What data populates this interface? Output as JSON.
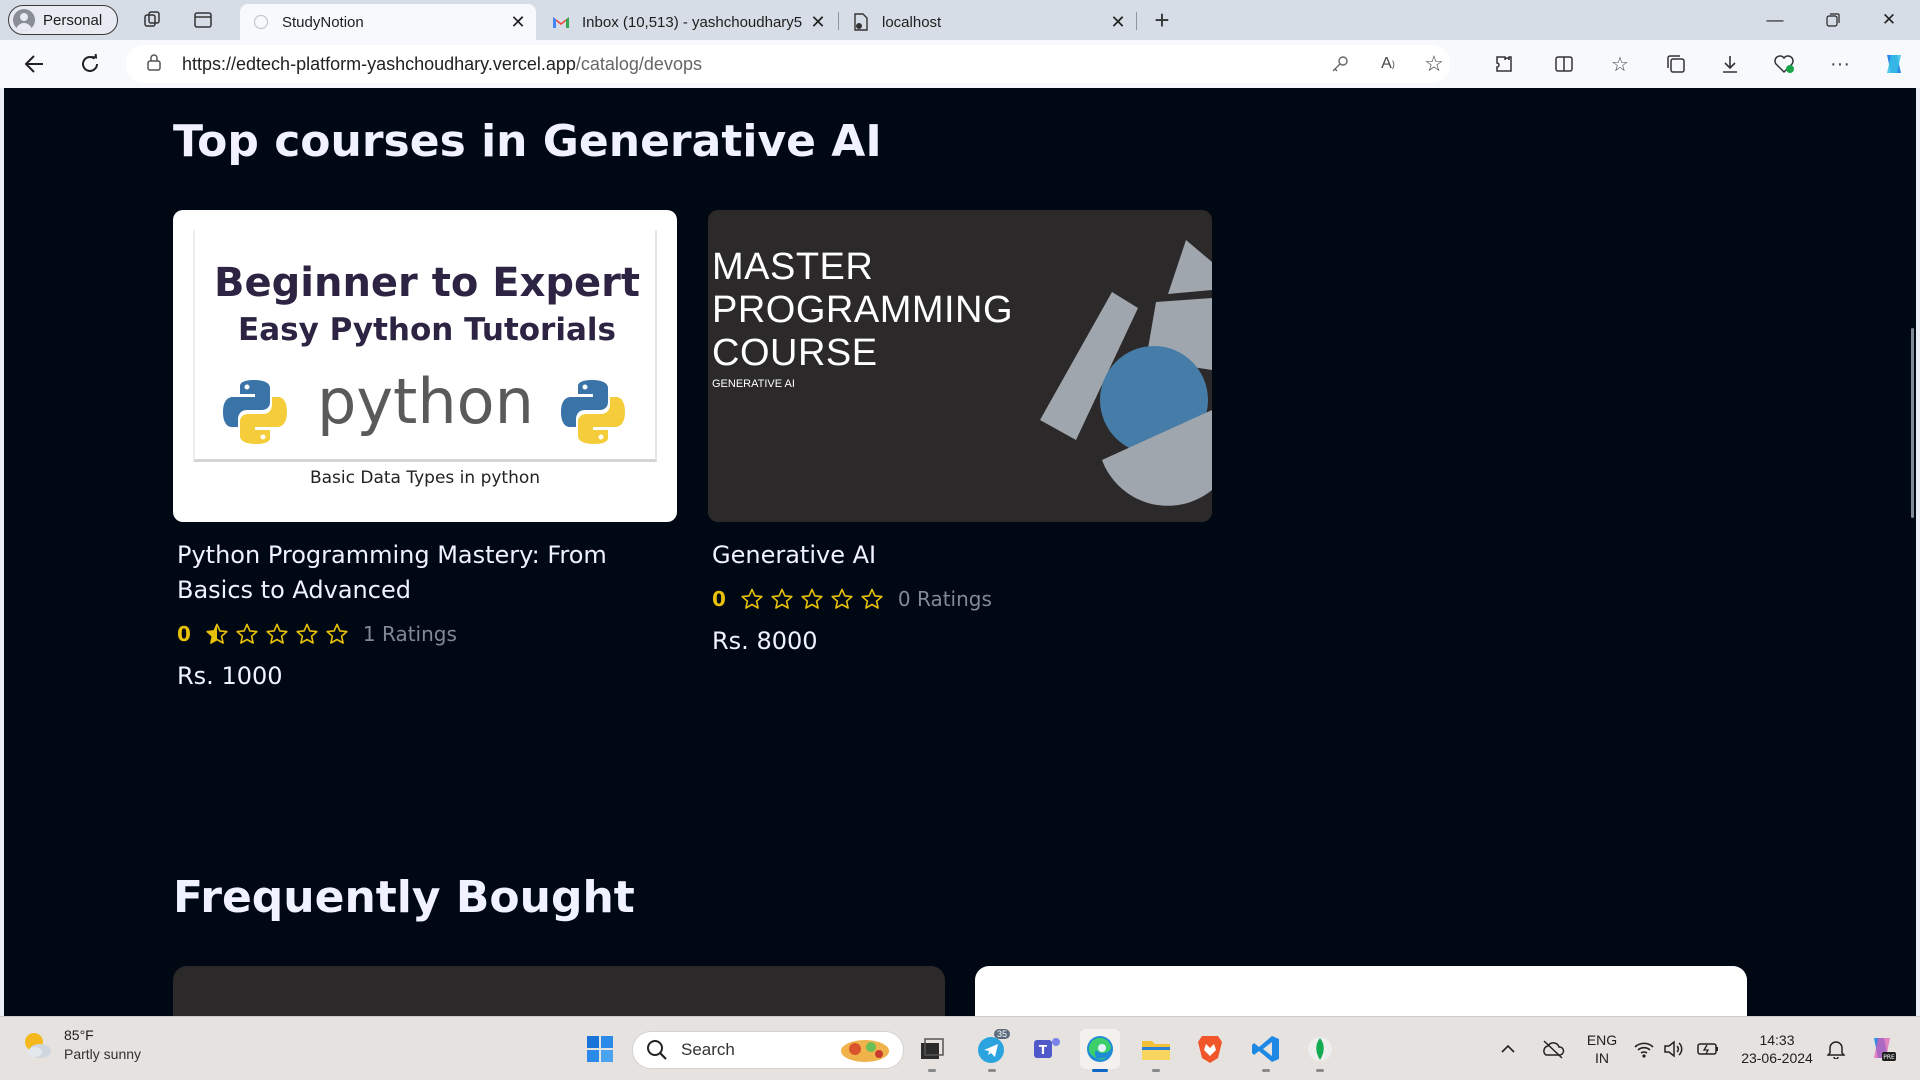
{
  "browser": {
    "profile_label": "Personal",
    "tabs": [
      {
        "title": "StudyNotion",
        "active": true
      },
      {
        "title": "Inbox (10,513) - yashchoudhary5",
        "active": false
      },
      {
        "title": "localhost",
        "active": false
      }
    ],
    "url_host": "https://edtech-platform-yashchoudhary.vercel.app",
    "url_path": "/catalog/devops"
  },
  "page": {
    "top_section_title": "Top courses in Generative AI",
    "courses": [
      {
        "name": "Python Programming Mastery: From Basics to Advanced",
        "avg_rating": "0",
        "rating_count": "1 Ratings",
        "price": "Rs. 1000",
        "thumb_line1": "Beginner to Expert",
        "thumb_line2": "Easy Python Tutorials",
        "thumb_word": "python",
        "thumb_caption": "Basic Data Types in python"
      },
      {
        "name": "Generative AI",
        "avg_rating": "0",
        "rating_count": "0 Ratings",
        "price": "Rs. 8000",
        "thumb_title_1": "MASTER",
        "thumb_title_2": "PROGRAMMING",
        "thumb_title_3": "COURSE",
        "thumb_sub": "GENERATIVE AI"
      }
    ],
    "frequently_bought_title": "Frequently Bought"
  },
  "taskbar": {
    "weather_temp": "85°F",
    "weather_desc": "Partly sunny",
    "search_placeholder": "Search",
    "lang_1": "ENG",
    "lang_2": "IN",
    "time": "14:33",
    "date": "23-06-2024",
    "telegram_badge": "35"
  },
  "colors": {
    "page_bg": "#000814",
    "rating_yellow": "#e7c009",
    "heading": "#f1f2ff",
    "muted": "#838894"
  }
}
